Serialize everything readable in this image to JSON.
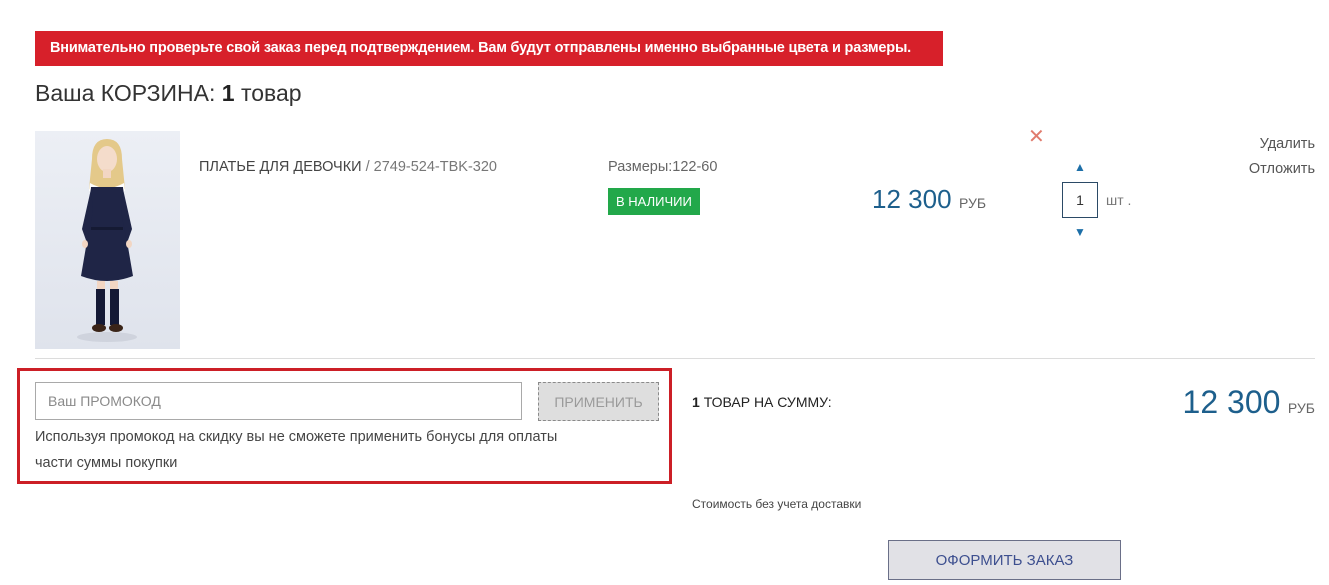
{
  "notice": {
    "text": "Внимательно проверьте свой заказ перед подтверждением. Вам будут отправлены именно выбранные цвета и размеры."
  },
  "cart": {
    "title_prefix": "Ваша КОРЗИНА:",
    "count": "1",
    "count_suffix": "товар"
  },
  "item": {
    "name": "ПЛАТЬЕ ДЛЯ ДЕВОЧКИ",
    "separator": "/",
    "sku": "2749-524-TBK-320",
    "sizes": "Размеры:122-60",
    "stock": "В НАЛИЧИИ",
    "price": "12 300",
    "currency": "РУБ",
    "remove_icon": "close-icon",
    "quantity": "1",
    "quantity_unit": "шт .",
    "actions": {
      "delete": "Удалить",
      "later": "Отложить"
    }
  },
  "promo": {
    "placeholder": "Ваш ПРОМОКОД",
    "apply_label": "ПРИМЕНИТЬ",
    "note": "Используя промокод на скидку вы не сможете применить бонусы для оплаты части суммы покупки"
  },
  "summary": {
    "count": "1",
    "label": "ТОВАР НА СУММУ:",
    "total": "12 300",
    "currency": "РУБ",
    "delivery_note": "Стоимость без учета доставки",
    "checkout_label": "ОФОРМИТЬ ЗАКАЗ"
  },
  "colors": {
    "notice_bg": "#d7202a",
    "stock_bg": "#22a84a",
    "price": "#1d5f8c",
    "promo_border": "#cc1f26"
  }
}
